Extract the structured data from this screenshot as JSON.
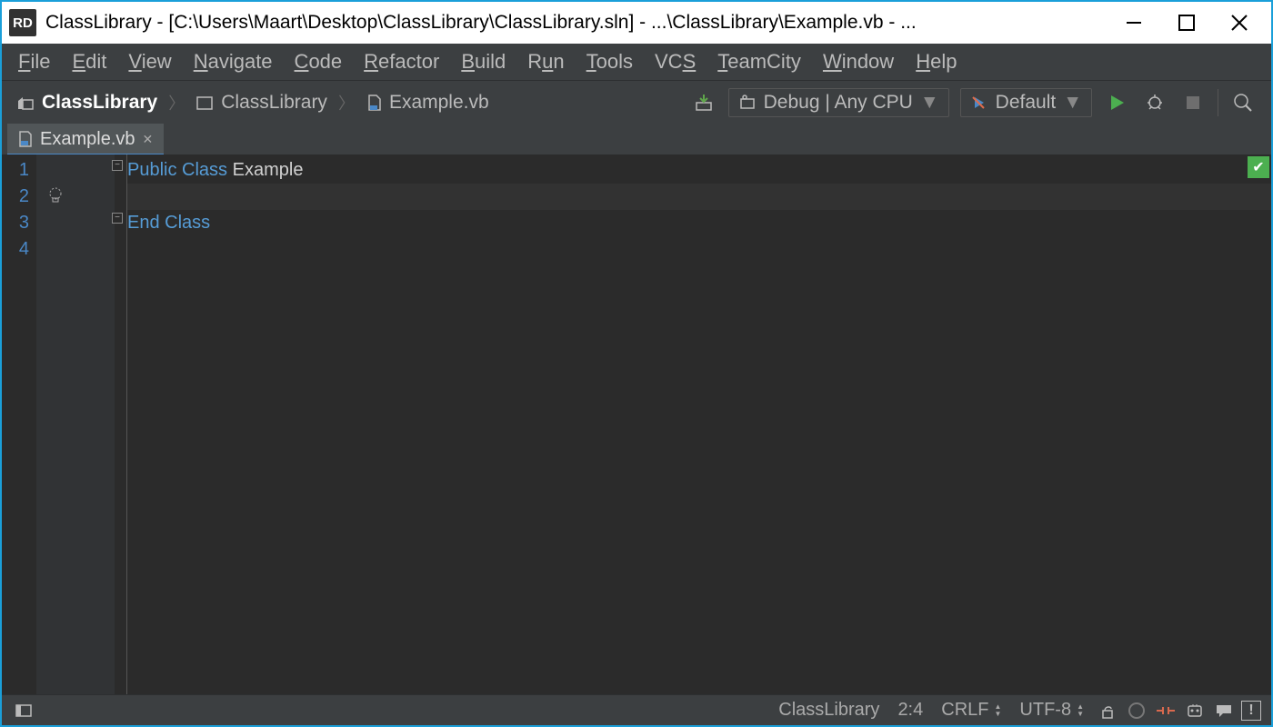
{
  "titlebar": {
    "app_initials": "RD",
    "title": "ClassLibrary - [C:\\Users\\Maart\\Desktop\\ClassLibrary\\ClassLibrary.sln] - ...\\ClassLibrary\\Example.vb - ..."
  },
  "menu": {
    "items": [
      "File",
      "Edit",
      "View",
      "Navigate",
      "Code",
      "Refactor",
      "Build",
      "Run",
      "Tools",
      "VCS",
      "TeamCity",
      "Window",
      "Help"
    ],
    "underline_index": [
      0,
      0,
      0,
      0,
      0,
      0,
      0,
      1,
      0,
      2,
      0,
      0,
      0
    ]
  },
  "breadcrumb": {
    "items": [
      "ClassLibrary",
      "ClassLibrary",
      "Example.vb"
    ],
    "bold_index": 0
  },
  "toolbar": {
    "config_label": "Debug | Any CPU",
    "profile_label": "Default"
  },
  "tabs": {
    "items": [
      {
        "label": "Example.vb",
        "active": true
      }
    ]
  },
  "editor": {
    "line_numbers": [
      "1",
      "2",
      "3",
      "4"
    ],
    "highlight_line": 2,
    "code_lines": [
      {
        "tokens": [
          {
            "t": "Public",
            "c": "kw"
          },
          {
            "t": " ",
            "c": ""
          },
          {
            "t": "Class",
            "c": "kw"
          },
          {
            "t": " ",
            "c": ""
          },
          {
            "t": "Example",
            "c": "id"
          }
        ]
      },
      {
        "tokens": []
      },
      {
        "tokens": [
          {
            "t": "End",
            "c": "kw"
          },
          {
            "t": " ",
            "c": ""
          },
          {
            "t": "Class",
            "c": "kw"
          }
        ]
      },
      {
        "tokens": []
      }
    ]
  },
  "status": {
    "context": "ClassLibrary",
    "cursor": "2:4",
    "line_sep": "CRLF",
    "encoding": "UTF-8"
  }
}
